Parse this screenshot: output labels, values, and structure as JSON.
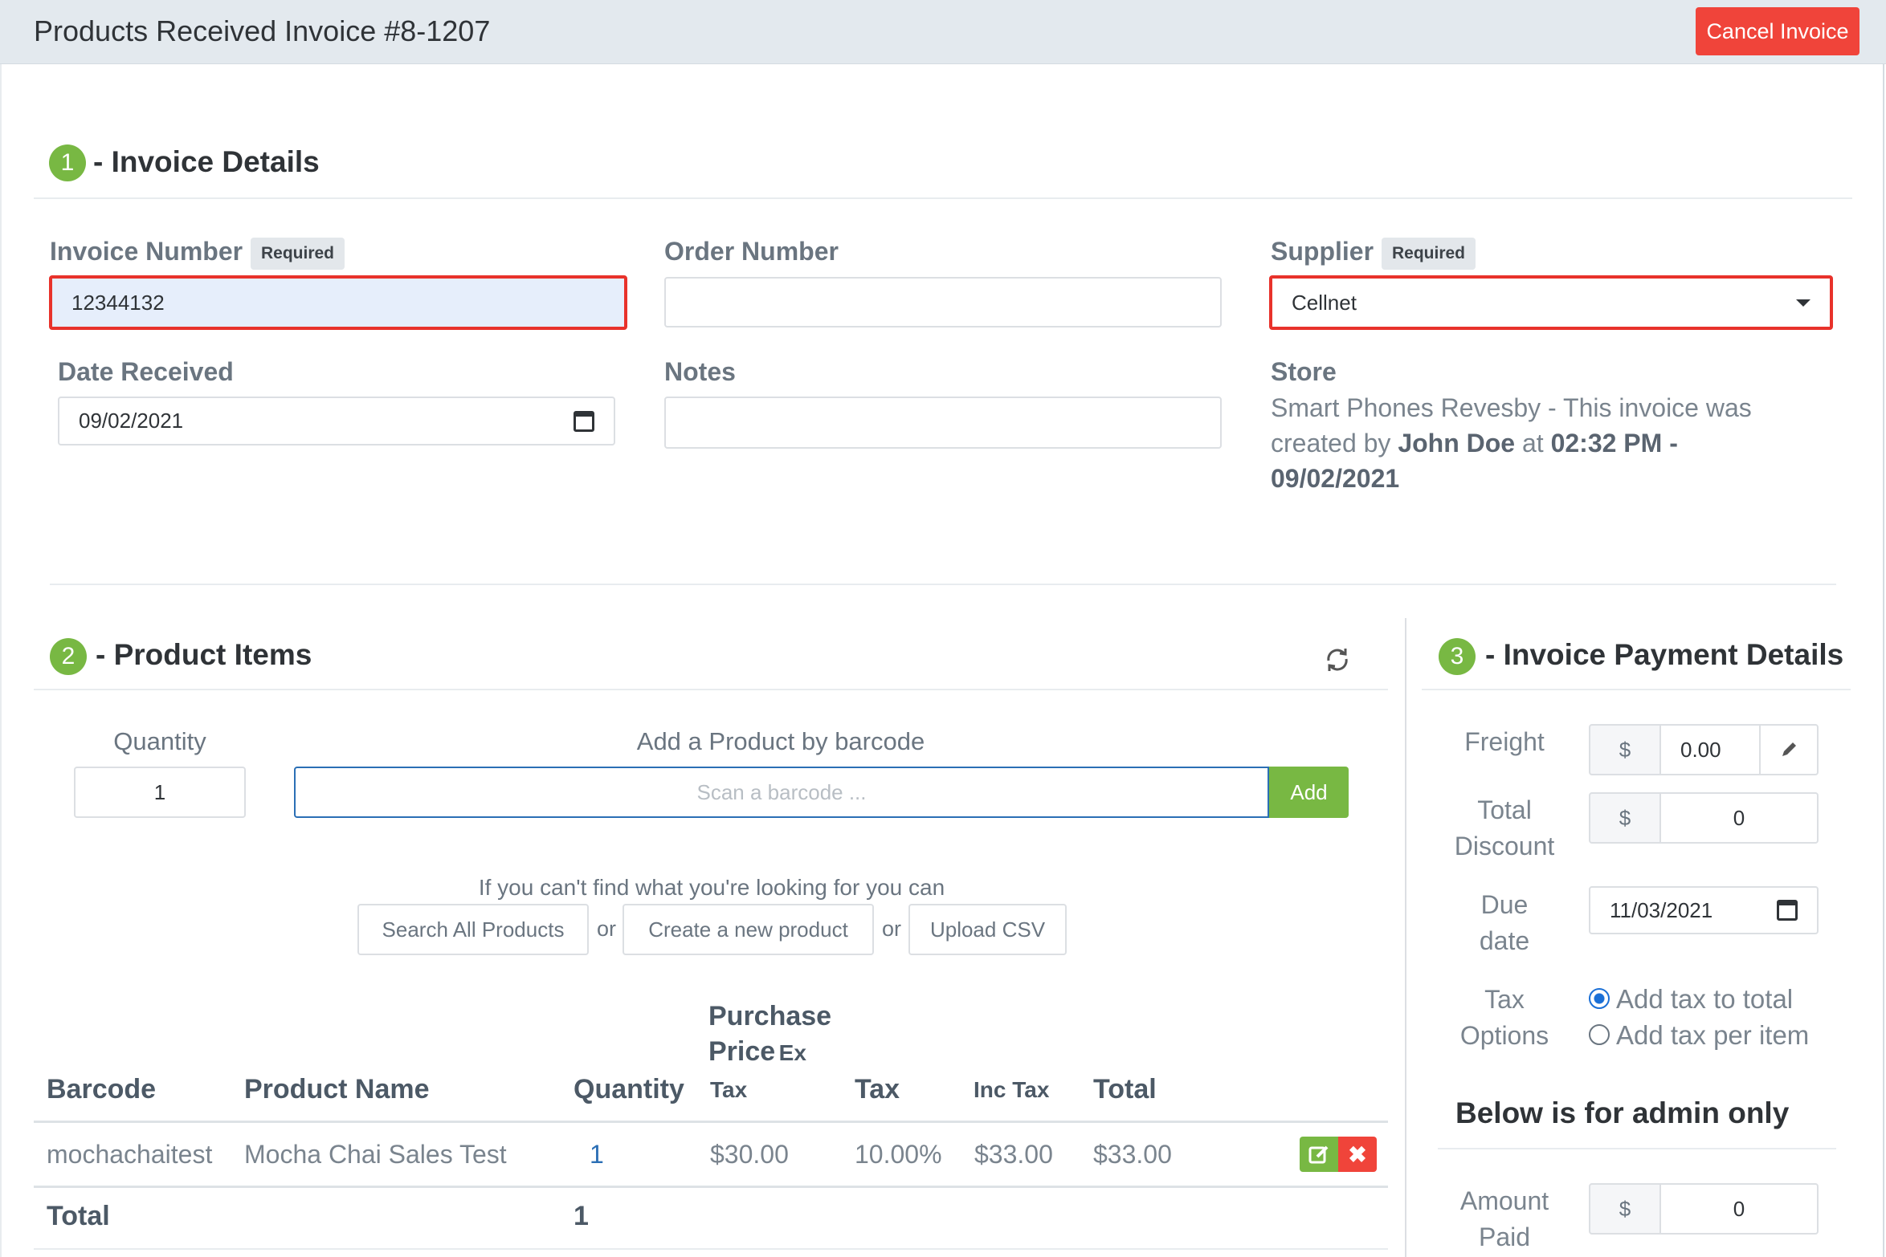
{
  "header": {
    "title": "Products Received Invoice #8-1207",
    "cancel_label": "Cancel Invoice"
  },
  "section1": {
    "number": "1",
    "title": "- Invoice Details",
    "invoice_number": {
      "label": "Invoice Number",
      "badge": "Required",
      "value": "12344132"
    },
    "order_number": {
      "label": "Order Number",
      "value": ""
    },
    "supplier": {
      "label": "Supplier",
      "badge": "Required",
      "value": "Cellnet"
    },
    "date_received": {
      "label": "Date Received",
      "value": "09/02/2021"
    },
    "notes": {
      "label": "Notes",
      "value": ""
    },
    "store": {
      "label": "Store",
      "line_prefix": "Smart Phones Revesby - This invoice was created by ",
      "user": "John Doe",
      "at": " at ",
      "datetime": "02:32 PM - 09/02/2021"
    }
  },
  "section2": {
    "number": "2",
    "title": "- Product Items",
    "quantity_label": "Quantity",
    "quantity_value": "1",
    "barcode_label": "Add a Product by barcode",
    "barcode_placeholder": "Scan a barcode ...",
    "add_label": "Add",
    "help_text": "If you can't find what you're looking for you can",
    "search_all_label": "Search All Products",
    "or1": "or",
    "create_label": "Create a new product",
    "or2": "or",
    "upload_label": "Upload CSV",
    "table": {
      "headers": {
        "barcode": "Barcode",
        "product_name": "Product Name",
        "quantity": "Quantity",
        "purchase_price_line1": "Purchase",
        "purchase_price_line2": "Price",
        "purchase_price_ex": "Ex",
        "purchase_price_tax": "Tax",
        "tax": "Tax",
        "inc_tax": "Inc Tax",
        "total": "Total"
      },
      "rows": [
        {
          "barcode": "mochachaitest",
          "product_name": "Mocha Chai Sales Test",
          "quantity": "1",
          "purchase_price": "$30.00",
          "tax": "10.00%",
          "inc_tax": "$33.00",
          "total": "$33.00"
        }
      ],
      "total_label": "Total",
      "total_quantity": "1"
    }
  },
  "section3": {
    "number": "3",
    "title": "- Invoice Payment Details",
    "freight": {
      "label": "Freight",
      "currency": "$",
      "value": "0.00"
    },
    "total_discount": {
      "label_line1": "Total",
      "label_line2": "Discount",
      "currency": "$",
      "value": "0"
    },
    "due_date": {
      "label_line1": "Due",
      "label_line2": "date",
      "value": "11/03/2021"
    },
    "tax_options": {
      "label_line1": "Tax",
      "label_line2": "Options",
      "option1": "Add tax to total",
      "option2": "Add tax per item",
      "selected": "option1"
    },
    "admin_title": "Below is for admin only",
    "amount_paid": {
      "label_line1": "Amount",
      "label_line2": "Paid",
      "currency": "$",
      "value": "0"
    }
  },
  "colors": {
    "accent_green": "#78b843",
    "danger_red": "#f0443a",
    "link_blue": "#2b6fb5"
  }
}
